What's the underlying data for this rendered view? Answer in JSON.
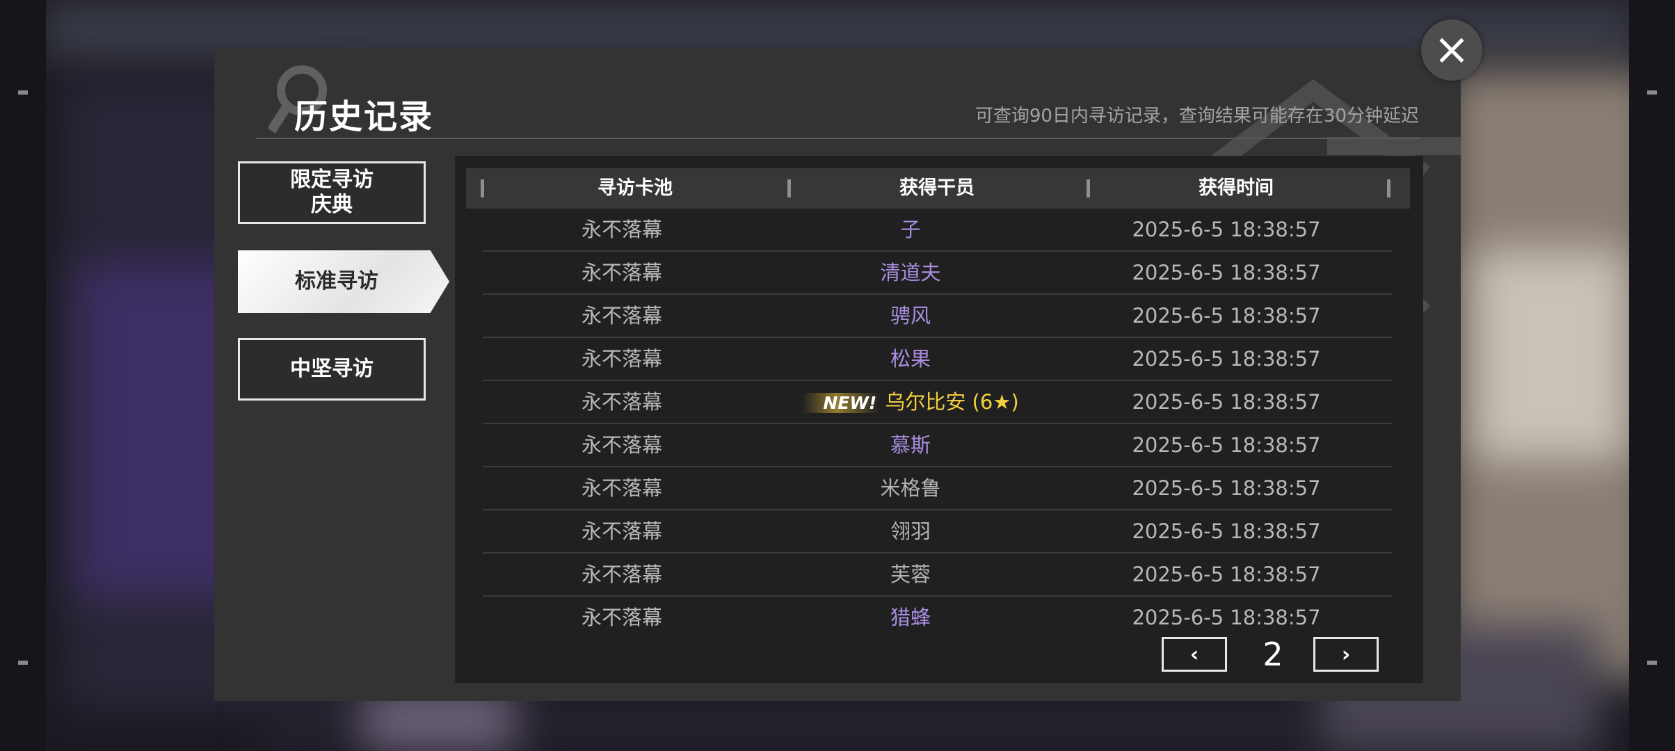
{
  "dialog": {
    "title": "历史记录",
    "hint": "可查询90日内寻访记录，查询结果可能存在30分钟延迟",
    "close_icon": "close-icon"
  },
  "sidebar": {
    "items": [
      {
        "label": "限定寻访\n庆典",
        "active": false
      },
      {
        "label": "标准寻访",
        "active": true
      },
      {
        "label": "中坚寻访",
        "active": false
      }
    ]
  },
  "table": {
    "headers": [
      "寻访卡池",
      "获得干员",
      "获得时间"
    ],
    "rows": [
      {
        "pool": "永不落幕",
        "operator": "子",
        "rarity": "purple",
        "time": "2025-6-5 18:38:57"
      },
      {
        "pool": "永不落幕",
        "operator": "清道夫",
        "rarity": "purple",
        "time": "2025-6-5 18:38:57"
      },
      {
        "pool": "永不落幕",
        "operator": "骋风",
        "rarity": "purple",
        "time": "2025-6-5 18:38:57"
      },
      {
        "pool": "永不落幕",
        "operator": "松果",
        "rarity": "purple",
        "time": "2025-6-5 18:38:57"
      },
      {
        "pool": "永不落幕",
        "operator": "乌尔比安 (6★)",
        "rarity": "gold",
        "new_tag": "NEW!",
        "time": "2025-6-5 18:38:57"
      },
      {
        "pool": "永不落幕",
        "operator": "慕斯",
        "rarity": "purple",
        "time": "2025-6-5 18:38:57"
      },
      {
        "pool": "永不落幕",
        "operator": "米格鲁",
        "rarity": "gray",
        "time": "2025-6-5 18:38:57"
      },
      {
        "pool": "永不落幕",
        "operator": "翎羽",
        "rarity": "gray",
        "time": "2025-6-5 18:38:57"
      },
      {
        "pool": "永不落幕",
        "operator": "芙蓉",
        "rarity": "gray",
        "time": "2025-6-5 18:38:57"
      },
      {
        "pool": "永不落幕",
        "operator": "猎蜂",
        "rarity": "purple",
        "time": "2025-6-5 18:38:57"
      }
    ]
  },
  "pager": {
    "prev_icon": "chevron-left-icon",
    "next_icon": "chevron-right-icon",
    "prev_glyph": "‹",
    "next_glyph": "›",
    "page": "2"
  },
  "colors": {
    "rarity_purple": "#a98ee0",
    "rarity_gold": "#f3cf3f",
    "rarity_gray": "#b2b2b2",
    "dialog_bg": "#333333",
    "panel_bg": "#202020"
  }
}
